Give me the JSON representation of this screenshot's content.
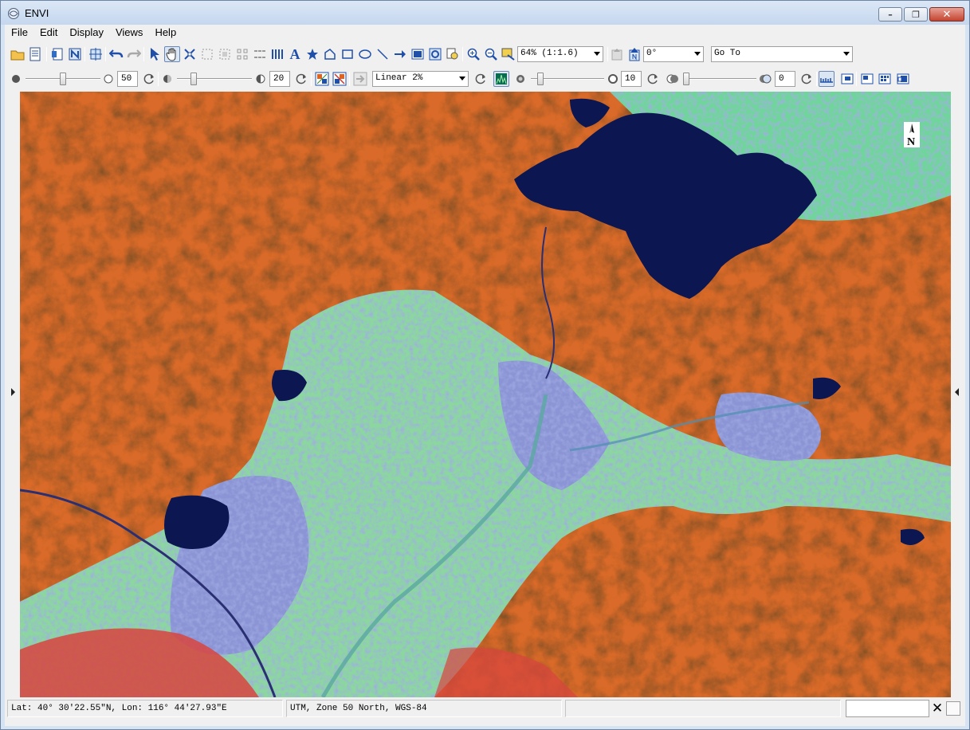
{
  "window": {
    "title": "ENVI"
  },
  "menu": [
    "File",
    "Edit",
    "Display",
    "Views",
    "Help"
  ],
  "toolbar1": {
    "zoom_level": "64% (1:1.6)",
    "rotation": "0°",
    "goto_placeholder": "Go To"
  },
  "toolbar2": {
    "brightness_value": "50",
    "contrast_value": "20",
    "stretch_type": "Linear 2%",
    "sharpen_value": "10",
    "transparency_value": "0",
    "brightness_level": 0.5,
    "contrast_level": 0.2,
    "sharpen_level": 0.1,
    "transparency_level": 0.0
  },
  "statusbar": {
    "coordinates": "Lat: 40° 30′22.55″N, Lon: 116° 44′27.93″E",
    "projection": "UTM, Zone 50 North, WGS-84",
    "field3": ""
  },
  "icons": {
    "north_arrow_label": "N"
  },
  "colors": {
    "vegetation": "#e0641f",
    "water": "#0c1650",
    "urban": "#8898d8",
    "cropland": "#78e09a",
    "bare": "#d8403a"
  }
}
